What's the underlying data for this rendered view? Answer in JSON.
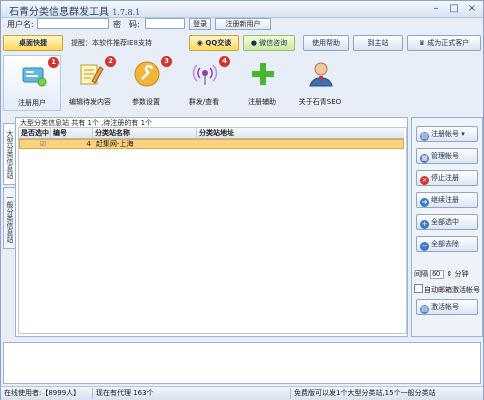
{
  "window": {
    "title": "石青分类信息群发工具",
    "version": "1.7.8.1",
    "controls": [
      "–",
      "□",
      "×"
    ]
  },
  "login": {
    "username_label": "用户名:",
    "username_value": "",
    "password_label": "密　码:",
    "password_value": "",
    "login_button": "登录",
    "register_button": "注册新用户"
  },
  "toolbar": {
    "desktop_shortcut": "桌面快捷",
    "hint": "提醒：本软件推荐IE8支持",
    "qq_chat": "QQ交谈",
    "wechat_consult": "微信咨询",
    "help": "使用帮助",
    "goto_site": "到主站",
    "become_official": "成为正式客户"
  },
  "iconbar": {
    "items": [
      {
        "label": "注册用户",
        "badge": "1",
        "icon": "user-card-icon"
      },
      {
        "label": "编辑待发内容",
        "badge": "2",
        "icon": "edit-notepad-icon"
      },
      {
        "label": "参数设置",
        "badge": "3",
        "icon": "wrench-settings-icon"
      },
      {
        "label": "群发/查看",
        "badge": "4",
        "icon": "broadcast-icon"
      },
      {
        "label": "注册辅助",
        "badge": "",
        "icon": "plus-icon"
      },
      {
        "label": "关于石青SEO",
        "badge": "",
        "icon": "person-icon"
      }
    ]
  },
  "tabs": {
    "large": "大型分类信息站",
    "general": "一般分类信息站"
  },
  "grid": {
    "caption": "大型分类信息站 共有 1个 ,待注册的有 1个",
    "columns": [
      "是否选中",
      "编号",
      "分类站名称",
      "分类站地址"
    ],
    "rows": [
      {
        "checked": "☑",
        "num": "4",
        "name": "赶集网-上海",
        "url": ""
      }
    ]
  },
  "right_panel": {
    "register_account": "注册帐号 ▾",
    "manage_account": "管理帐号",
    "stop_register": "停止注册",
    "continue_register": "继续注册",
    "select_all": "全部选中",
    "deselect_all": "全部去除",
    "interval_label": "间隔",
    "interval_value": "60",
    "interval_unit": "分钟",
    "auto_mailbox_label": "自动邮箱激活帐号",
    "activate_account": "激活帐号"
  },
  "status": {
    "online": "在线使用者:【8999人】",
    "proxy": "现在有代理 163个",
    "notice": "免费版可以发1个大型分类站,15个一般分类站"
  },
  "colors": {
    "accent_yellow": "#fcd27c",
    "badge_red": "#d9302b",
    "frame_blue": "#9eb3d2"
  }
}
